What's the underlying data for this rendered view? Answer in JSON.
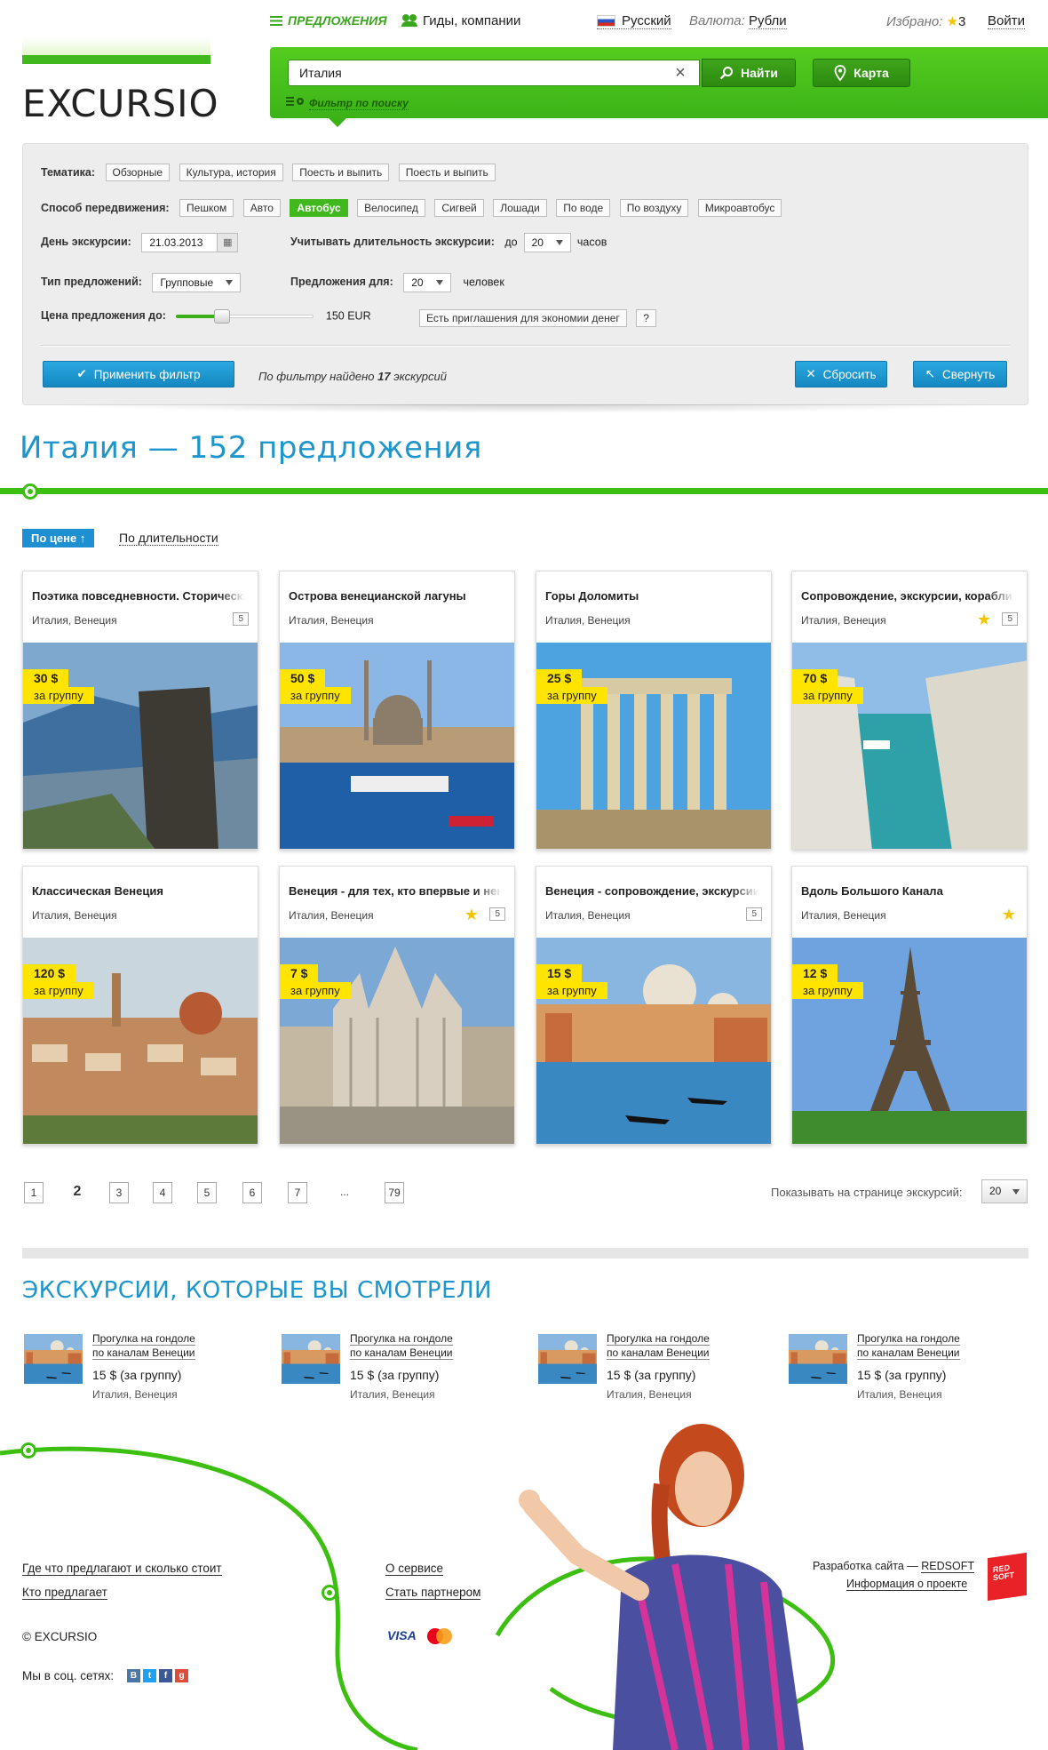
{
  "nav": {
    "offers": "Предложения",
    "guides": "Гиды, компании",
    "language": "Русский",
    "currency_label": "Валюта:",
    "currency_value": "Рубли",
    "favorites_label": "Избрано:",
    "favorites_count": "3",
    "login": "Войти"
  },
  "logo": {
    "text": "EXCURSIO"
  },
  "search": {
    "value": "Италия",
    "find_label": "Найти",
    "map_label": "Карта",
    "filter_link": "Фильтр по поиску"
  },
  "filter": {
    "theme_label": "Тематика:",
    "theme_tags": [
      "Обзорные",
      "Культура, история",
      "Поесть и выпить",
      "Поесть и выпить"
    ],
    "transport_label": "Способ передвижения:",
    "transport_tags": [
      "Пешком",
      "Авто",
      "Автобус",
      "Велосипед",
      "Сигвей",
      "Лошади",
      "По воде",
      "По воздуху",
      "Микроавтобус"
    ],
    "transport_active": "Автобус",
    "day_label": "День экскурсии:",
    "day_value": "21.03.2013",
    "duration_label": "Учитывать длительность экскурсии:",
    "duration_prefix": "до",
    "duration_value": "20",
    "duration_unit": "часов",
    "type_label": "Тип предложений:",
    "type_value": "Групповые",
    "for_label": "Предложения для:",
    "for_value": "20",
    "for_unit": "человек",
    "price_label": "Цена предложения до:",
    "price_value": "150 EUR",
    "price_slider_fraction": 0.33,
    "invite_label": "Есть приглашения для экономии денег",
    "help_label": "?",
    "apply_label": "Применить фильтр",
    "found_prefix": "По фильтру найдено",
    "found_count": "17",
    "found_suffix": "экскурсий",
    "reset_label": "Сбросить",
    "collapse_label": "Свернуть"
  },
  "page_title": "Италия — 152 предложения",
  "sort": {
    "active": "По цене",
    "other": "По длительности"
  },
  "cards": [
    {
      "title": "Поэтика повседневности. Сторические",
      "location": "Италия, Венеция",
      "reviews": "5",
      "star": false,
      "price": "30 $",
      "unit": "за группу",
      "scene": "cliff"
    },
    {
      "title": "Острова венецианской лагуны",
      "location": "Италия, Венеция",
      "reviews": "",
      "star": false,
      "price": "50 $",
      "unit": "за группу",
      "scene": "mosque"
    },
    {
      "title": "Горы Доломиты",
      "location": "Италия, Венеция",
      "reviews": "",
      "star": false,
      "price": "25 $",
      "unit": "за группу",
      "scene": "temple"
    },
    {
      "title": "Сопровождение, экскурсии, корабли",
      "location": "Италия, Венеция",
      "reviews": "5",
      "star": true,
      "price": "70 $",
      "unit": "за группу",
      "scene": "sea"
    },
    {
      "title": "Классическая Венеция",
      "location": "Италия, Венеция",
      "reviews": "",
      "star": false,
      "price": "120 $",
      "unit": "за группу",
      "scene": "florence"
    },
    {
      "title": "Венеция - для тех, кто впервые и нена",
      "location": "Италия, Венеция",
      "reviews": "5",
      "star": true,
      "price": "7 $",
      "unit": "за группу",
      "scene": "cathedral"
    },
    {
      "title": "Венеция - сопровождение, экскурсии",
      "location": "Италия, Венеция",
      "reviews": "5",
      "star": false,
      "price": "15 $",
      "unit": "за группу",
      "scene": "venice"
    },
    {
      "title": "Вдоль Большого Канала",
      "location": "Италия, Венеция",
      "reviews": "",
      "star": true,
      "price": "12 $",
      "unit": "за группу",
      "scene": "eiffel"
    }
  ],
  "pagination": {
    "pages": [
      "1",
      "2",
      "3",
      "4",
      "5",
      "6",
      "7",
      "...",
      "79"
    ],
    "current": "2",
    "per_page_label": "Показывать на странице экскурсий:",
    "per_page_value": "20"
  },
  "viewed": {
    "title": "ЭКСКУРСИИ, КОТОРЫЕ ВЫ СМОТРЕЛИ",
    "items": [
      {
        "title1": "Прогулка на гондоле",
        "title2": "по каналам Венеции",
        "price": "15 $ (за группу)",
        "location": "Италия, Венеция"
      },
      {
        "title1": "Прогулка на гондоле",
        "title2": "по каналам Венеции",
        "price": "15 $ (за группу)",
        "location": "Италия, Венеция"
      },
      {
        "title1": "Прогулка на гондоле",
        "title2": "по каналам Венеции",
        "price": "15 $ (за группу)",
        "location": "Италия, Венеция"
      },
      {
        "title1": "Прогулка на гондоле",
        "title2": "по каналам Венеции",
        "price": "15 $ (за группу)",
        "location": "Италия, Венеция"
      }
    ]
  },
  "footer": {
    "link1": "Где что предлагают и сколько стоит",
    "link2": "Кто предлагает",
    "link3": "О сервисе",
    "link4": "Стать партнером",
    "copyright": "© EXCURSIO",
    "social_label": "Мы в соц. сетях:",
    "visa": "VISA",
    "dev_prefix": "Разработка сайта —",
    "dev_name": "REDSOFT",
    "project_info": "Информация о проекте",
    "redsoft_logo": "RED SOFT"
  }
}
